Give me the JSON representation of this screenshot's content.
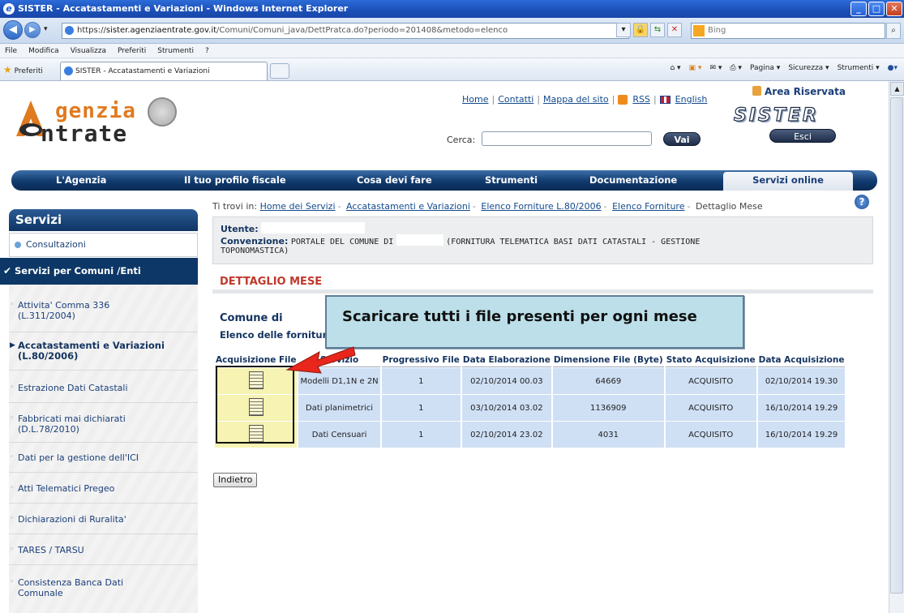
{
  "window": {
    "title": "SISTER - Accatastamenti e Variazioni - Windows Internet Explorer",
    "url_protocol": "https://",
    "url_host": "sister.agenziaentrate.gov.it",
    "url_path": "/Comuni/Comuni_java/DettPratca.do?periodo=201408&metodo=elenco",
    "search_placeholder": "Bing"
  },
  "menu": [
    "File",
    "Modifica",
    "Visualizza",
    "Preferiti",
    "Strumenti",
    "?"
  ],
  "favorites": {
    "label": "Preferiti",
    "tab_title": "SISTER - Accatastamenti e Variazioni",
    "commands": [
      "Pagina ▾",
      "Sicurezza ▾",
      "Strumenti ▾"
    ]
  },
  "header": {
    "logo_line1": "genzia",
    "logo_line2": "ntrate",
    "links": [
      "Home",
      "Contatti",
      "Mappa del sito",
      "RSS",
      "English"
    ],
    "search_label": "Cerca:",
    "search_button": "Vai",
    "area_riservata": "Area Riservata",
    "sister_logo": "SISTER",
    "esci_button": "Esci"
  },
  "mainnav": [
    "L'Agenzia",
    "Il tuo profilo fiscale",
    "Cosa devi fare",
    "Strumenti",
    "Documentazione",
    "Servizi online"
  ],
  "sidebar": {
    "title": "Servizi",
    "consultazioni": "Consultazioni",
    "active_section": "Servizi per Comuni /Enti",
    "items": [
      {
        "line1": "Attivita' Comma 336",
        "line2": "(L.311/2004)"
      },
      {
        "line1": "Accatastamenti e Variazioni",
        "line2": "(L.80/2006)"
      },
      {
        "line1": "Estrazione Dati Catastali",
        "line2": ""
      },
      {
        "line1": "Fabbricati mai dichiarati",
        "line2": "(D.L.78/2010)"
      },
      {
        "line1": "Dati per la gestione dell'ICI",
        "line2": ""
      },
      {
        "line1": "Atti Telematici Pregeo",
        "line2": ""
      },
      {
        "line1": "Dichiarazioni di Ruralita'",
        "line2": ""
      },
      {
        "line1": "TARES / TARSU",
        "line2": ""
      },
      {
        "line1": "Consistenza Banca Dati",
        "line2": "Comunale"
      }
    ]
  },
  "breadcrumb": {
    "prefix": "Ti trovi in:",
    "links": [
      "Home dei Servizi",
      "Accatastamenti e Variazioni",
      "Elenco Forniture L.80/2006",
      "Elenco Forniture"
    ],
    "current": "Dettaglio Mese"
  },
  "userbox": {
    "utente_label": "Utente:",
    "convenzione_label": "Convenzione:",
    "convenzione_value_a": "PORTALE DEL COMUNE DI",
    "convenzione_value_b": "(FORNITURA TELEMATICA BASI DATI CATASTALI - GESTIONE",
    "convenzione_value_c": "TOPONOMASTICA)"
  },
  "content": {
    "section_title": "DETTAGLIO MESE",
    "comune_label": "Comune di",
    "elenco_label": "Elenco delle forniture",
    "callout": "Scaricare tutti  i file presenti  per ogni mese",
    "back_button": "Indietro"
  },
  "table": {
    "headers": [
      "Acquisizione File",
      "Servizio",
      "Progressivo File",
      "Data Elaborazione",
      "Dimensione File (Byte)",
      "Stato Acquisizione",
      "Data Acquisizione"
    ],
    "rows": [
      [
        "",
        "Modelli D1,1N e 2N",
        "1",
        "02/10/2014 00.03",
        "64669",
        "ACQUISITO",
        "02/10/2014 19.30"
      ],
      [
        "",
        "Dati planimetrici",
        "1",
        "03/10/2014 03.02",
        "1136909",
        "ACQUISITO",
        "16/10/2014 19.29"
      ],
      [
        "",
        "Dati Censuari",
        "1",
        "02/10/2014 23.02",
        "4031",
        "ACQUISITO",
        "16/10/2014 19.29"
      ]
    ]
  },
  "colors": {
    "nav_blue": "#0c3766",
    "link_blue": "#124a8e",
    "title_red": "#c0392b",
    "callout_bg": "#bcdfe9",
    "row_blue": "#cfe0f5",
    "file_cell": "#f6f3b3",
    "arrow_red": "#e8261b"
  }
}
